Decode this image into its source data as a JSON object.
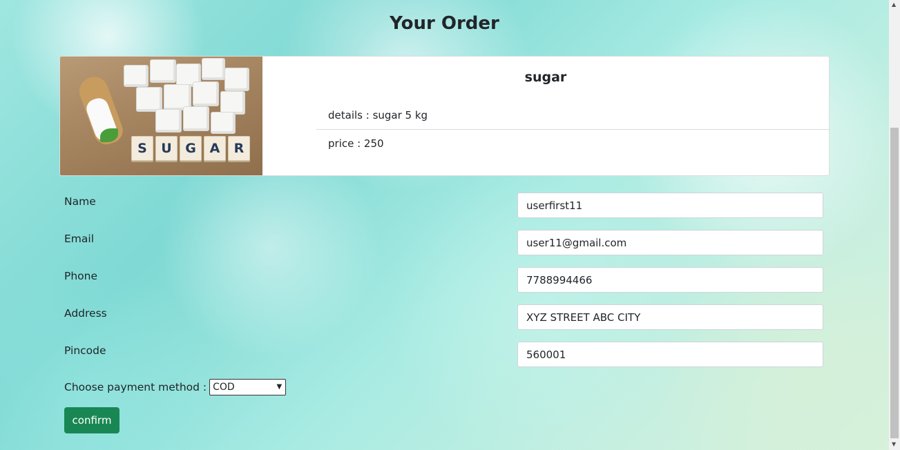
{
  "page": {
    "title": "Your Order"
  },
  "product": {
    "name": "sugar",
    "image_tiles": [
      "S",
      "U",
      "G",
      "A",
      "R"
    ],
    "details_text": "details : sugar 5 kg",
    "price_text": "price : 250"
  },
  "form": {
    "name_label": "Name",
    "name_value": "userfirst11",
    "email_label": "Email",
    "email_value": "user11@gmail.com",
    "phone_label": "Phone",
    "phone_value": "7788994466",
    "address_label": "Address",
    "address_value": "XYZ STREET ABC CITY",
    "pincode_label": "Pincode",
    "pincode_value": "560001",
    "payment_label": "Choose payment method :",
    "payment_selected": "COD",
    "confirm_label": "confirm"
  },
  "colors": {
    "confirm_button": "#198754",
    "card_background": "#ffffff"
  },
  "icons": {
    "select_arrow": "chevron-down-icon"
  }
}
